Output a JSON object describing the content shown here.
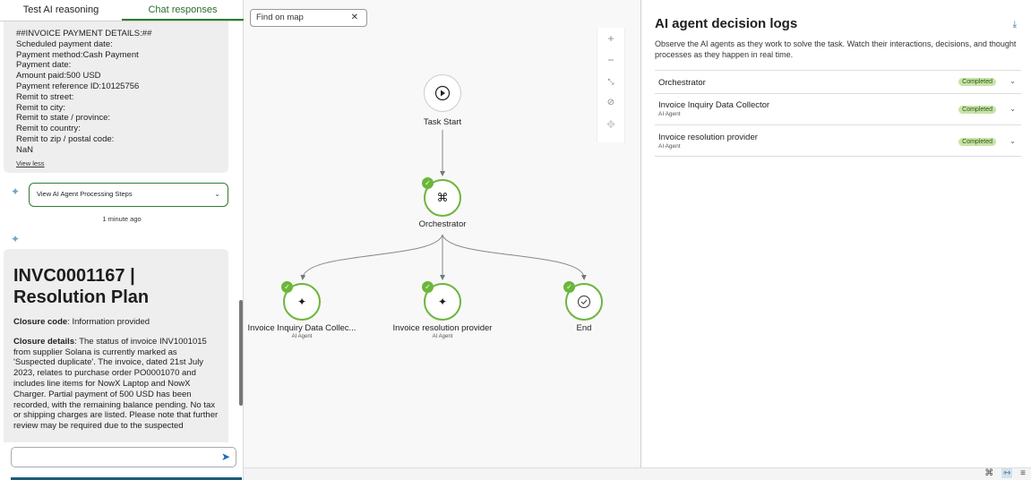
{
  "tabs": [
    {
      "label": "Test AI reasoning"
    },
    {
      "label": "Chat responses"
    }
  ],
  "chat": {
    "payment_lines": [
      "##INVOICE PAYMENT DETAILS:##",
      "Scheduled payment date:",
      "Payment method:Cash Payment",
      "Payment date:",
      "Amount paid:500 USD",
      "Payment reference ID:10125756",
      "Remit to street:",
      "Remit to city:",
      "Remit to state / province:",
      "Remit to country:",
      "Remit to zip / postal code:",
      "NaN"
    ],
    "view_less": "View less",
    "steps_button": "View AI Agent Processing Steps",
    "time_ago": "1 minute ago",
    "plan_title": "INVC0001167 | Resolution Plan",
    "closure_code_label": "Closure code",
    "closure_code_value": ": Information provided",
    "closure_details_label": "Closure details",
    "closure_details_value": ": The status of invoice INV1001015 from supplier Solana is currently marked as 'Suspected duplicate'. The invoice, dated 21st July 2023, relates to purchase order PO0001070 and includes line items for NowX Laptop and NowX Charger. Partial payment of 500 USD has been recorded, with the remaining balance pending. No tax or shipping charges are listed. Please note that further review may be required due to the suspected",
    "input_value": ""
  },
  "map": {
    "find_placeholder": "Find on map",
    "nodes": {
      "start": {
        "label": "Task Start"
      },
      "orchestrator": {
        "label": "Orchestrator"
      },
      "collector": {
        "label": "Invoice Inquiry Data Collec...",
        "sub": "AI Agent"
      },
      "provider": {
        "label": "Invoice resolution provider",
        "sub": "AI Agent"
      },
      "end": {
        "label": "End"
      }
    },
    "zoom_controls": [
      "plus-icon",
      "minus-icon",
      "collapse-icon",
      "hide-icon",
      "move-icon"
    ]
  },
  "logs": {
    "title": "AI agent decision logs",
    "description": "Observe the AI agents as they work to solve the task. Watch their interactions, decisions, and thought processes as they happen in real time.",
    "agents": [
      {
        "name": "Orchestrator",
        "sub": "",
        "status": "Completed"
      },
      {
        "name": "Invoice Inquiry Data Collector",
        "sub": "AI Agent",
        "status": "Completed"
      },
      {
        "name": "Invoice resolution provider",
        "sub": "AI Agent",
        "status": "Completed"
      }
    ]
  },
  "colors": {
    "accent_green": "#2e7d32",
    "node_green": "#6bb63a",
    "badge_bg": "#c7e3a7",
    "link_blue": "#1e6bb8"
  }
}
